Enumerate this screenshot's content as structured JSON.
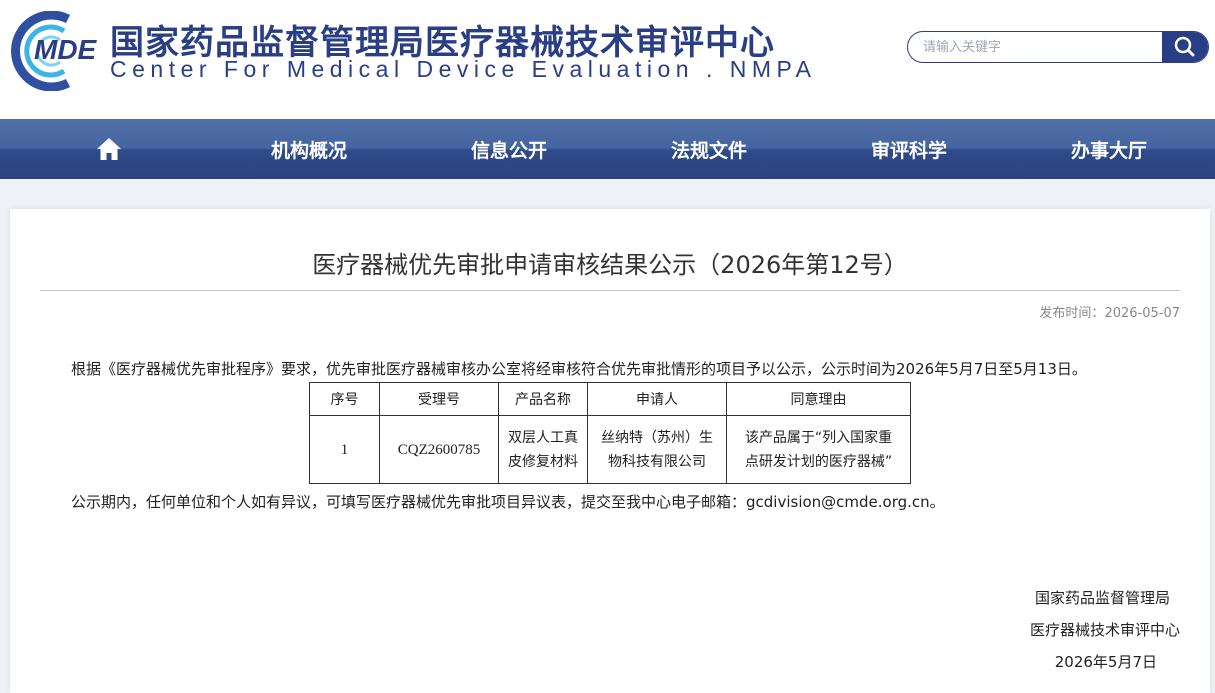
{
  "header": {
    "logo_text": "MDE",
    "title_cn": "国家药品监督管理局医疗器械技术审评中心",
    "title_en": "Center For Medical Device Evaluation . NMPA",
    "search_placeholder": "请输入关键字"
  },
  "nav": {
    "home_icon": "home-icon",
    "items": [
      {
        "label": "机构概况"
      },
      {
        "label": "信息公开"
      },
      {
        "label": "法规文件"
      },
      {
        "label": "审评科学"
      },
      {
        "label": "办事大厅"
      }
    ]
  },
  "article": {
    "title": "医疗器械优先审批申请审核结果公示（2026年第12号）",
    "publish_label": "发布时间：",
    "publish_date": "2026-05-07",
    "intro": "根据《医疗器械优先审批程序》要求，优先审批医疗器械审核办公室将经审核符合优先审批情形的项目予以公示，公示时间为2026年5月7日至5月13日。",
    "table": {
      "headers": [
        "序号",
        "受理号",
        "产品名称",
        "申请人",
        "同意理由"
      ],
      "rows": [
        {
          "index": "1",
          "number": "CQZ2600785",
          "product_line1": "双层人工真",
          "product_line2": "皮修复材料",
          "applicant_line1": "丝纳特（苏州）生",
          "applicant_line2": "物科技有限公司",
          "reason_line1": "该产品属于“列入国家重",
          "reason_line2": "点研发计划的医疗器械”"
        }
      ]
    },
    "notice": "公示期内，任何单位和个人如有异议，可填写医疗器械优先审批项目异议表，提交至我中心电子邮箱：gcdivision@cmde.org.cn。",
    "signature": {
      "line1": "国家药品监督管理局",
      "line2": "医疗器械技术审评中心",
      "line3": "2026年5月7日"
    }
  },
  "colors": {
    "brand_blue": "#2a3e86",
    "nav_blue": "#3a5592"
  }
}
